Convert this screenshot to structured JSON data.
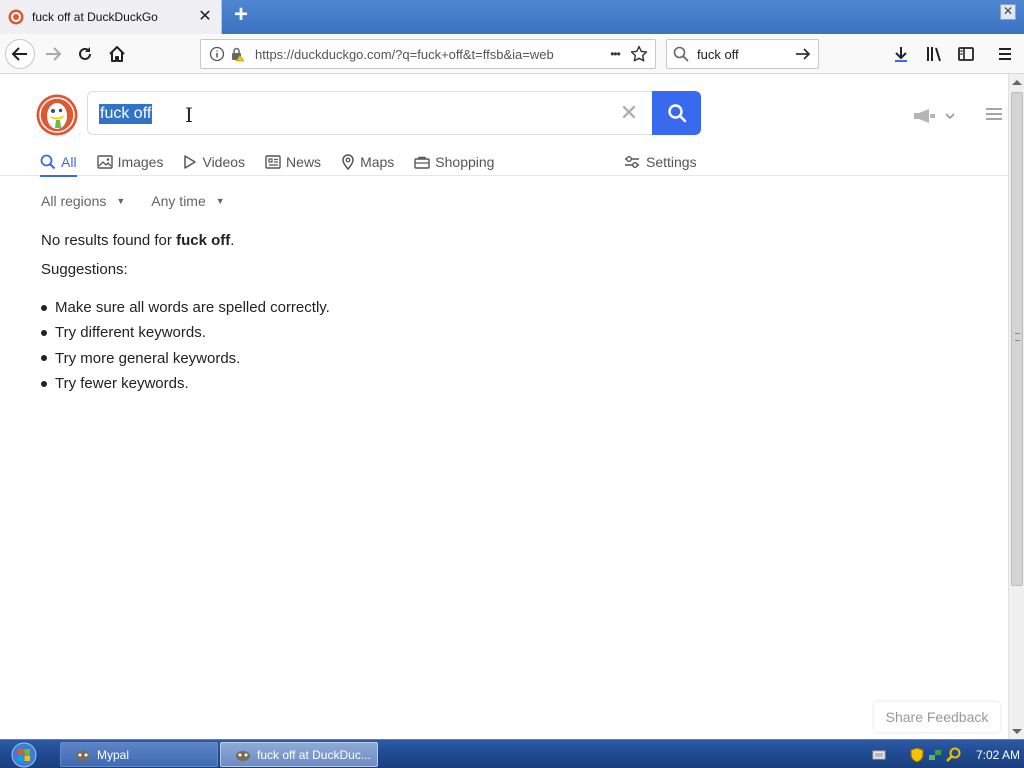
{
  "browser": {
    "tab_title": "fuck off at DuckDuckGo",
    "new_tab_symbol": "+",
    "close_symbol": "✕",
    "window_close_symbol": "✕",
    "url": "https://duckduckgo.com/?q=fuck+off&t=ffsb&ia=web",
    "search_box_value": "fuck off",
    "page_actions_symbol": "•••"
  },
  "ddg": {
    "query": "fuck off",
    "clear_symbol": "✕",
    "tabs": [
      {
        "label": "All",
        "icon": "search-icon"
      },
      {
        "label": "Images",
        "icon": "image-icon"
      },
      {
        "label": "Videos",
        "icon": "play-icon"
      },
      {
        "label": "News",
        "icon": "news-icon"
      },
      {
        "label": "Maps",
        "icon": "map-pin-icon"
      },
      {
        "label": "Shopping",
        "icon": "shopping-bag-icon"
      }
    ],
    "settings_label": "Settings",
    "filters": {
      "region": "All regions",
      "time": "Any time",
      "caret": "▼"
    },
    "results": {
      "no_results_prefix": "No results found for ",
      "no_results_query": "fuck off",
      "no_results_suffix": ".",
      "suggestions_title": "Suggestions:",
      "suggestions": [
        "Make sure all words are spelled correctly.",
        "Try different keywords.",
        "Try more general keywords.",
        "Try fewer keywords."
      ]
    },
    "feedback_label": "Share Feedback"
  },
  "taskbar": {
    "task1": "Mypal",
    "task2": "fuck off at DuckDuc...",
    "clock": "7:02 AM"
  },
  "colors": {
    "accent": "#3969ef",
    "selection": "#3173c6",
    "ddg_orange": "#de5833"
  }
}
